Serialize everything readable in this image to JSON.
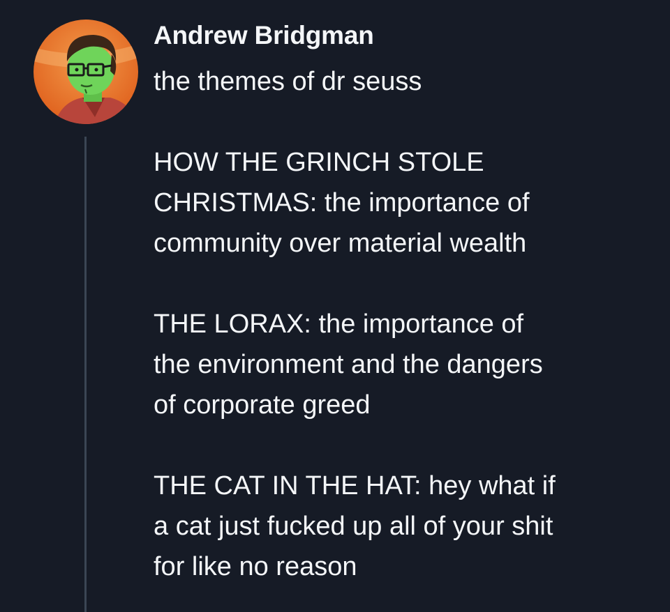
{
  "tweet": {
    "author_name": "Andrew Bridgman",
    "avatar_icon": "cartoon-avatar-icon",
    "lines": [
      "the themes of dr seuss",
      "",
      "HOW THE GRINCH STOLE",
      "CHRISTMAS: the importance of",
      "community over material wealth",
      "",
      "THE LORAX: the importance of",
      "the environment and the dangers",
      "of corporate greed",
      "",
      "THE CAT IN THE HAT: hey what if",
      "a cat just fucked up all of your shit",
      "for like no reason"
    ]
  },
  "colors": {
    "background": "#161b26",
    "text": "#f4f6f8",
    "thread_line": "#3b4654",
    "avatar_bg": "#e8742a"
  }
}
